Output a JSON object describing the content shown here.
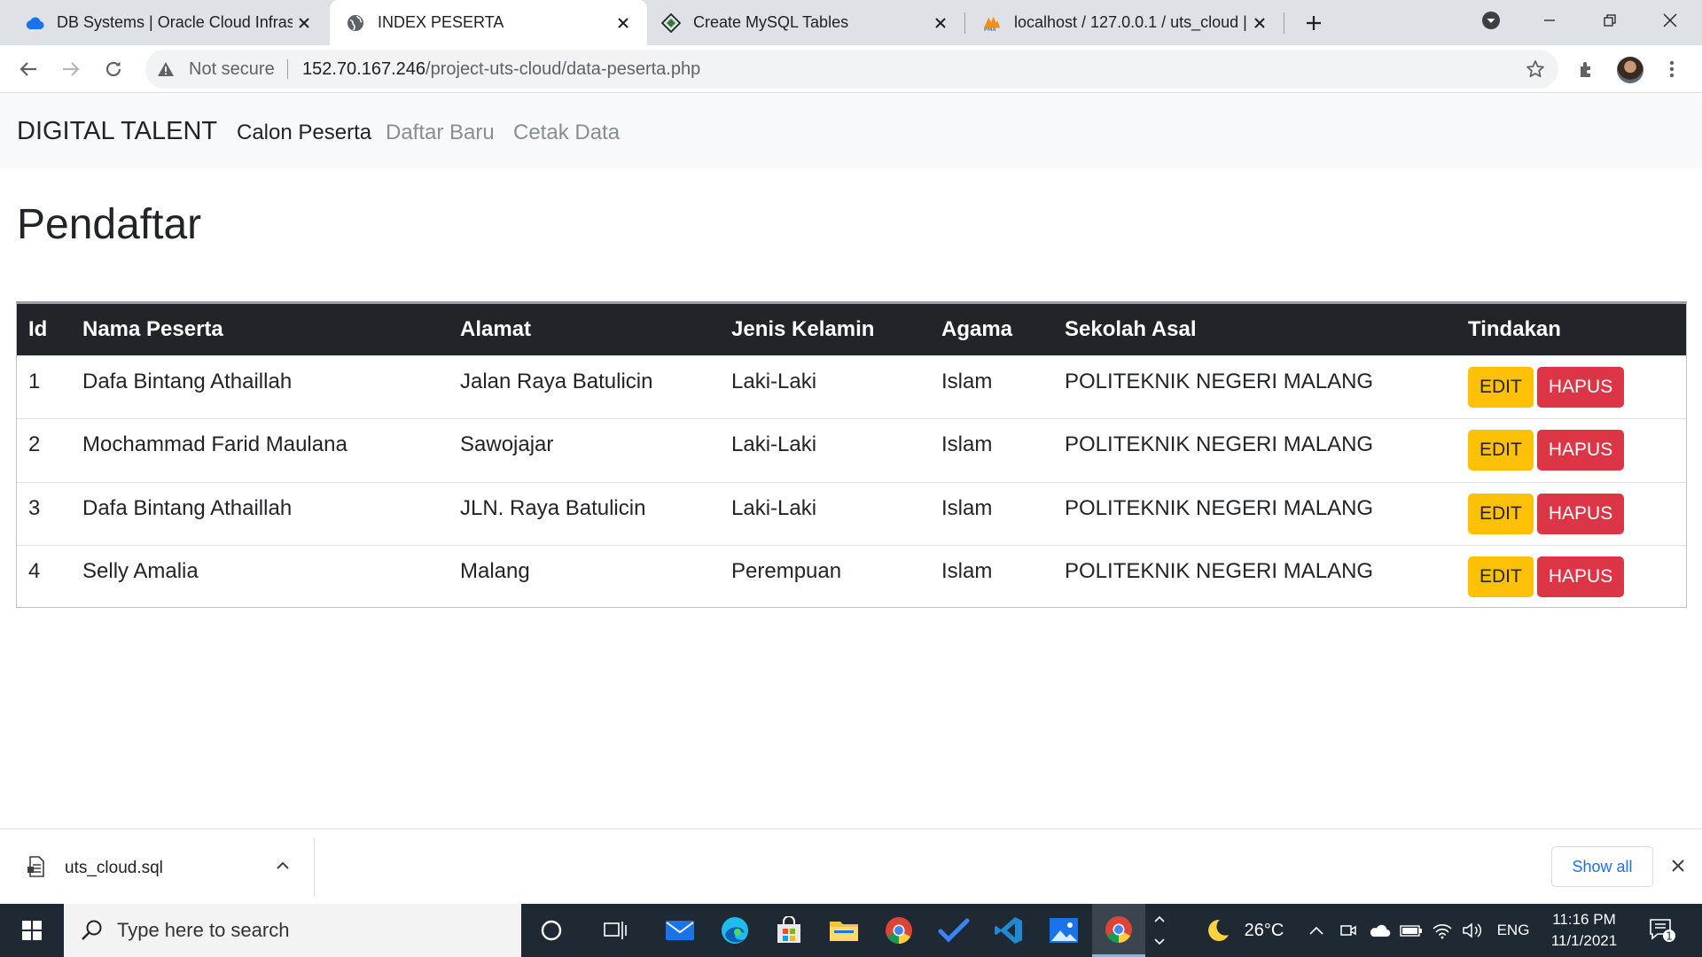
{
  "browser": {
    "tabs": [
      {
        "title": "DB Systems | Oracle Cloud Infrast",
        "icon": "cloud-icon"
      },
      {
        "title": "INDEX PESERTA",
        "icon": "globe-icon"
      },
      {
        "title": "Create MySQL Tables",
        "icon": "diamond-icon"
      },
      {
        "title": "localhost / 127.0.0.1 / uts_cloud |",
        "icon": "phpmyadmin-icon"
      }
    ],
    "active_tab": 1,
    "address": {
      "security_label": "Not secure",
      "url_host": "152.70.167.246",
      "url_path": "/project-uts-cloud/data-peserta.php"
    }
  },
  "page": {
    "brand": "DIGITAL TALENT",
    "nav": [
      "Calon Peserta",
      "Daftar Baru",
      "Cetak Data"
    ],
    "heading": "Pendaftar",
    "table": {
      "headers": [
        "Id",
        "Nama Peserta",
        "Alamat",
        "Jenis Kelamin",
        "Agama",
        "Sekolah Asal",
        "Tindakan"
      ],
      "rows": [
        [
          "1",
          "Dafa Bintang Athaillah",
          "Jalan Raya Batulicin",
          "Laki-Laki",
          "Islam",
          "POLITEKNIK NEGERI MALANG"
        ],
        [
          "2",
          "Mochammad Farid Maulana",
          "Sawojajar",
          "Laki-Laki",
          "Islam",
          "POLITEKNIK NEGERI MALANG"
        ],
        [
          "3",
          "Dafa Bintang Athaillah",
          "JLN. Raya Batulicin",
          "Laki-Laki",
          "Islam",
          "POLITEKNIK NEGERI MALANG"
        ],
        [
          "4",
          "Selly Amalia",
          "Malang",
          "Perempuan",
          "Islam",
          "POLITEKNIK NEGERI MALANG"
        ]
      ],
      "actions": {
        "edit": "EDIT",
        "delete": "HAPUS"
      }
    }
  },
  "downloads": {
    "file": "uts_cloud.sql",
    "show_all": "Show all"
  },
  "taskbar": {
    "search_placeholder": "Type here to search",
    "weather": "26°C",
    "language": "ENG",
    "time": "11:16 PM",
    "date": "11/1/2021",
    "notification_count": "1"
  },
  "colors": {
    "navbar_bg": "#f8f9fa",
    "table_head_bg": "#212529",
    "edit_button": "#ffc107",
    "delete_button": "#dc3545",
    "link_blue": "#1a73e8"
  }
}
